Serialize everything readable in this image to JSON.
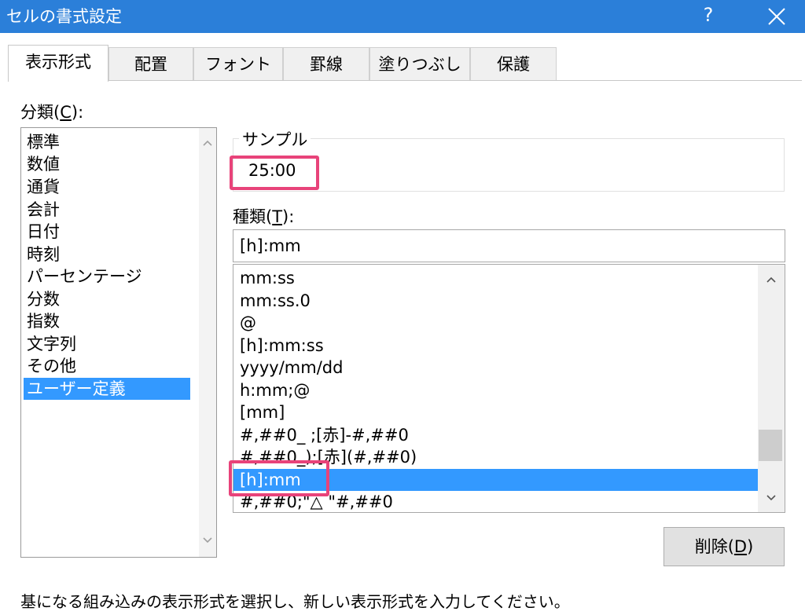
{
  "window": {
    "title": "セルの書式設定",
    "help": "?"
  },
  "tabs": [
    {
      "label": "表示形式",
      "active": true
    },
    {
      "label": "配置"
    },
    {
      "label": "フォント"
    },
    {
      "label": "罫線"
    },
    {
      "label": "塗りつぶし"
    },
    {
      "label": "保護"
    }
  ],
  "category": {
    "label": "分類",
    "accel": "C",
    "items": [
      "標準",
      "数値",
      "通貨",
      "会計",
      "日付",
      "時刻",
      "パーセンテージ",
      "分数",
      "指数",
      "文字列",
      "その他",
      "ユーザー定義"
    ],
    "selected": "ユーザー定義"
  },
  "sample": {
    "legend": "サンプル",
    "value": "25:00"
  },
  "type": {
    "label": "種類",
    "accel": "T",
    "input_value": "[h]:mm",
    "items": [
      "mm:ss",
      "mm:ss.0",
      "@",
      "[h]:mm:ss",
      "yyyy/mm/dd",
      "h:mm;@",
      "[mm]",
      "#,##0_ ;[赤]-#,##0",
      "#,##0_);[赤](#,##0)",
      "[h]:mm",
      "#,##0;\"△ \"#,##0"
    ],
    "selected": "[h]:mm"
  },
  "delete_button": {
    "label": "削除",
    "accel": "D"
  },
  "footer": "基になる組み込みの表示形式を選択し、新しい表示形式を入力してください。",
  "colors": {
    "titlebar": "#2b7fd9",
    "selection": "#3399ff",
    "highlight": "#e8437a"
  }
}
